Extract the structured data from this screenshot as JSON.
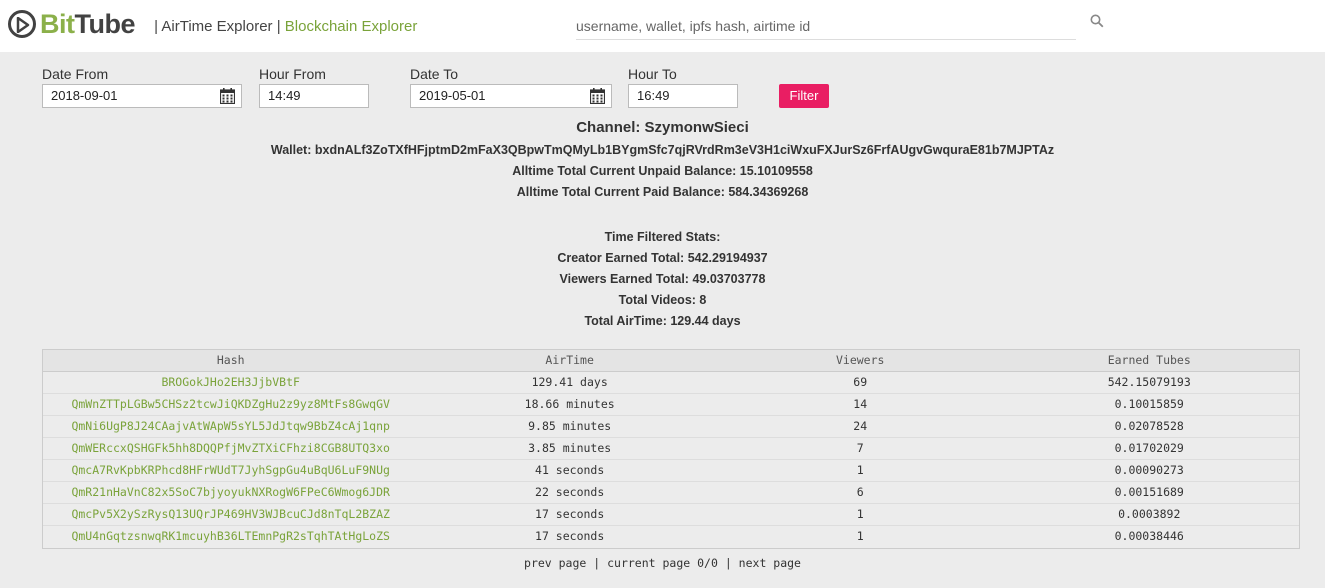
{
  "header": {
    "logo_bit": "Bit",
    "logo_tube": "Tube",
    "nav_sep1": " | ",
    "nav_airtime": "AirTime Explorer",
    "nav_sep2": " | ",
    "nav_blockchain": "Blockchain Explorer",
    "search_placeholder": "username, wallet, ipfs hash, airtime id"
  },
  "filters": {
    "date_from_label": "Date From",
    "date_from_value": "2018-09-01",
    "hour_from_label": "Hour From",
    "hour_from_value": "14:49",
    "date_to_label": "Date To",
    "date_to_value": "2019-05-01",
    "hour_to_label": "Hour To",
    "hour_to_value": "16:49",
    "filter_button": "Filter"
  },
  "channel": {
    "title": "Channel: SzymonwSieci",
    "wallet": "Wallet: bxdnALf3ZoTXfHFjptmD2mFaX3QBpwTmQMyLb1BYgmSfc7qjRVrdRm3eV3H1ciWxuFXJurSz6FrfAUgvGwquraE81b7MJPTAz",
    "unpaid": "Alltime Total Current Unpaid Balance: 15.10109558",
    "paid": "Alltime Total Current Paid Balance: 584.34369268"
  },
  "stats": {
    "heading": "Time Filtered Stats:",
    "creator": "Creator Earned Total: 542.29194937",
    "viewers": "Viewers Earned Total: 49.03703778",
    "videos": "Total Videos: 8",
    "airtime": "Total AirTime: 129.44 days"
  },
  "table": {
    "headers": [
      "Hash",
      "AirTime",
      "Viewers",
      "Earned Tubes"
    ],
    "rows": [
      [
        "BROGokJHo2EH3JjbVBtF",
        "129.41 days",
        "69",
        "542.15079193"
      ],
      [
        "QmWnZTTpLGBw5CHSz2tcwJiQKDZgHu2z9yz8MtFs8GwqGV",
        "18.66 minutes",
        "14",
        "0.10015859"
      ],
      [
        "QmNi6UgP8J24CAajvAtWApW5sYL5JdJtqw9BbZ4cAj1qnp",
        "9.85 minutes",
        "24",
        "0.02078528"
      ],
      [
        "QmWERccxQSHGFk5hh8DQQPfjMvZTXiCFhzi8CGB8UTQ3xo",
        "3.85 minutes",
        "7",
        "0.01702029"
      ],
      [
        "QmcA7RvKpbKRPhcd8HFrWUdT7JyhSgpGu4uBqU6LuF9NUg",
        "41 seconds",
        "1",
        "0.00090273"
      ],
      [
        "QmR21nHaVnC82x5SoC7bjyoyukNXRogW6FPeC6Wmog6JDR",
        "22 seconds",
        "6",
        "0.00151689"
      ],
      [
        "QmcPv5X2ySzRysQ13UQrJP469HV3WJBcuCJd8nTqL2BZAZ",
        "17 seconds",
        "1",
        "0.0003892"
      ],
      [
        "QmU4nGqtzsnwqRK1mcuyhB36LTEmnPgR2sTqhTAtHgLoZS",
        "17 seconds",
        "1",
        "0.00038446"
      ]
    ]
  },
  "pager": {
    "prev": "prev page",
    "sep1": " | ",
    "current": "current page 0/0",
    "sep2": " | ",
    "next": "next page"
  },
  "colors": {
    "accent_green": "#7aa33a",
    "filter_button": "#e91e63",
    "logo_dark": "#424242"
  },
  "icons": {
    "logo": "play-circle-icon",
    "search": "search-icon",
    "calendar": "calendar-icon"
  }
}
